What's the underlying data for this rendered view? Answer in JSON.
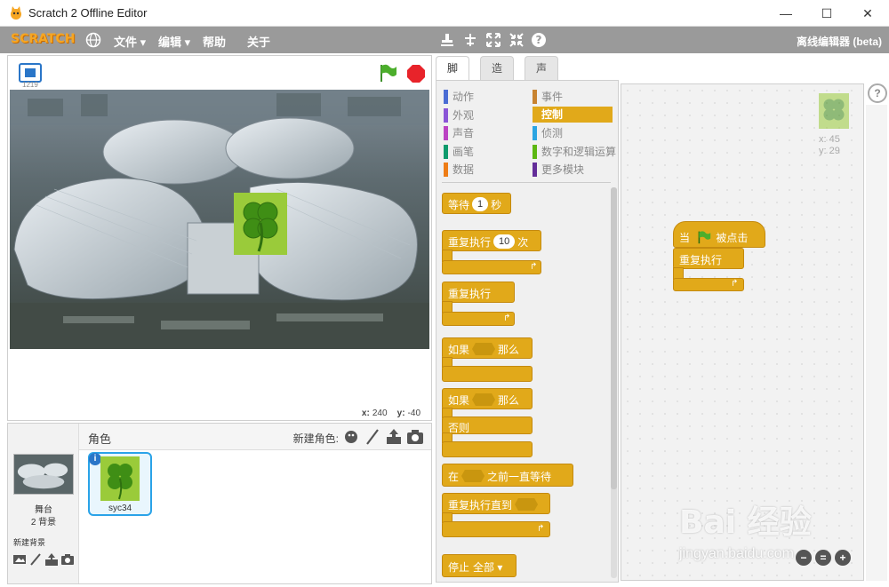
{
  "window": {
    "title": "Scratch 2 Offline Editor",
    "minimize": "—",
    "maximize": "☐",
    "close": "✕"
  },
  "menubar": {
    "logo": "SCRATCH",
    "menus": [
      "文件 ▾",
      "编辑 ▾",
      "帮助",
      "关于"
    ],
    "edition": "离线编辑器 (beta)",
    "tools": [
      "stamp-icon",
      "cut-icon",
      "grow-icon",
      "shrink-icon",
      "help-icon"
    ]
  },
  "stage": {
    "version": "1219",
    "mouse_x_label": "x:",
    "mouse_x": "240",
    "mouse_y_label": "y:",
    "mouse_y": "-40"
  },
  "sprites": {
    "title": "角色",
    "new_sprite_label": "新建角色:",
    "stage_label": "舞台",
    "stage_backdrops": "2 背景",
    "new_backdrop_label": "新建背景",
    "items": [
      {
        "name": "syc34"
      }
    ]
  },
  "tabs": [
    "脚本",
    "造型",
    "声音"
  ],
  "categories": {
    "left": [
      {
        "label": "动作",
        "color": "#4a6cd4"
      },
      {
        "label": "外观",
        "color": "#8a55d7"
      },
      {
        "label": "声音",
        "color": "#bb42c3"
      },
      {
        "label": "画笔",
        "color": "#0e9a6c"
      },
      {
        "label": "数据",
        "color": "#ee7d16"
      }
    ],
    "right": [
      {
        "label": "事件",
        "color": "#c88330"
      },
      {
        "label": "控制",
        "color": "#e1a91a"
      },
      {
        "label": "侦测",
        "color": "#2ca5e2"
      },
      {
        "label": "数字和逻辑运算",
        "color": "#5cb712"
      },
      {
        "label": "更多模块",
        "color": "#632d99"
      }
    ]
  },
  "blocks": {
    "wait": "等待",
    "wait_value": "1",
    "wait_unit": "秒",
    "repeat": "重复执行",
    "repeat_value": "10",
    "repeat_unit": "次",
    "forever": "重复执行",
    "if": "如果",
    "then": "那么",
    "if2": "如果",
    "then2": "那么",
    "else": "否则",
    "wait_until_prefix": "在",
    "wait_until_suffix": "之前一直等待",
    "repeat_until": "重复执行直到",
    "stop": "停止",
    "stop_option": "全部 ▾"
  },
  "script": {
    "hat_prefix": "当",
    "hat_suffix": "被点击",
    "forever": "重复执行",
    "sprite_x": "x: 45",
    "sprite_y": "y: 29"
  },
  "watermark": {
    "brand": "Bai 经验",
    "url": "jingyan.baidu.com"
  },
  "colors": {
    "control": "#e1a91a",
    "events": "#c88330",
    "menubar": "#9a9a9a",
    "selection": "#2aa3e8"
  }
}
